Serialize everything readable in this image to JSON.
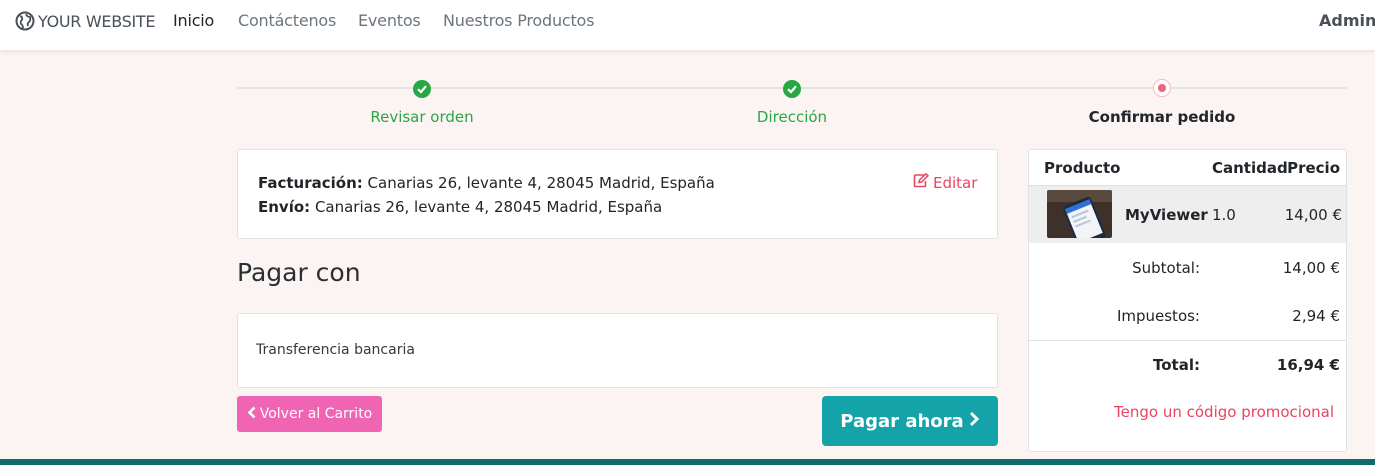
{
  "header": {
    "brand": "YOUR WEBSITE",
    "nav": [
      {
        "label": "Inicio",
        "active": true
      },
      {
        "label": "Contáctenos"
      },
      {
        "label": "Eventos"
      },
      {
        "label": "Nuestros Productos"
      }
    ],
    "user": "Adminis"
  },
  "wizard": {
    "steps": [
      {
        "label": "Revisar orden",
        "state": "done"
      },
      {
        "label": "Dirección",
        "state": "done"
      },
      {
        "label": "Confirmar pedido",
        "state": "current"
      }
    ]
  },
  "address": {
    "billing_label": "Facturación:",
    "billing_value": "Canarias 26, levante 4, 28045 Madrid, España",
    "shipping_label": "Envío:",
    "shipping_value": "Canarias 26, levante 4, 28045 Madrid, España",
    "edit_label": "Editar",
    "edit_icon": "edit-icon"
  },
  "payment": {
    "title": "Pagar con",
    "option": "Transferencia bancaria"
  },
  "actions": {
    "back_label": "Volver al Carrito",
    "pay_label": "Pagar ahora"
  },
  "summary": {
    "headers": {
      "product": "Producto",
      "qty": "Cantidad",
      "price": "Precio"
    },
    "items": [
      {
        "name": "MyViewer",
        "qty": "1.0",
        "price": "14,00 €"
      }
    ],
    "subtotal_label": "Subtotal:",
    "subtotal_value": "14,00 €",
    "tax_label": "Impuestos:",
    "tax_value": "2,94 €",
    "total_label": "Total:",
    "total_value": "16,94 €",
    "promo_label": "Tengo un código promocional"
  },
  "colors": {
    "success": "#28a745",
    "accent": "#e8455f",
    "back_button": "#f064b4",
    "pay_button": "#13a3a8",
    "footer": "#0f6c6c"
  }
}
